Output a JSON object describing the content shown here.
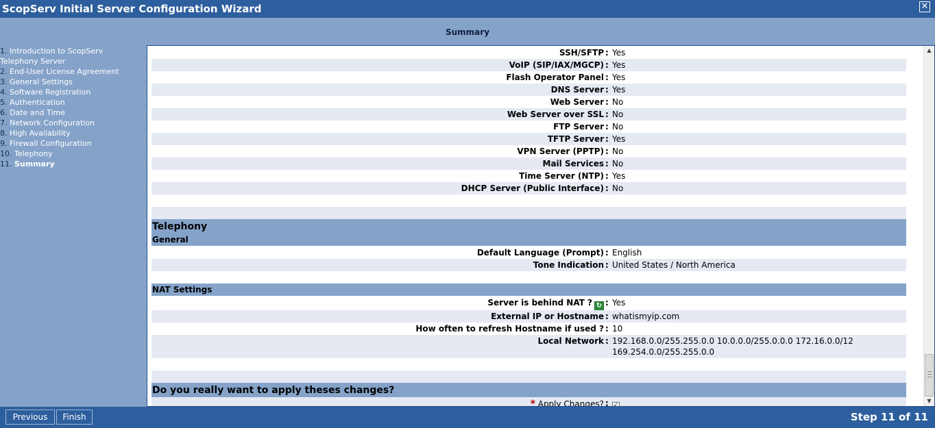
{
  "window": {
    "title": "ScopServ Initial Server Configuration Wizard",
    "close_glyph": "✕"
  },
  "header": {
    "title": "Summary"
  },
  "sidebar": {
    "steps": [
      {
        "num": "1.",
        "label": "Introduction to ScopServ",
        "label2": "Telephony Server"
      },
      {
        "num": "2.",
        "label": "End-User License Agreement"
      },
      {
        "num": "3.",
        "label": "General Settings"
      },
      {
        "num": "4.",
        "label": "Software Registration"
      },
      {
        "num": "5.",
        "label": "Authentication"
      },
      {
        "num": "6.",
        "label": "Date and Time"
      },
      {
        "num": "7.",
        "label": "Network Configuration"
      },
      {
        "num": "8.",
        "label": "High Availability"
      },
      {
        "num": "9.",
        "label": "Firewall Configuration"
      },
      {
        "num": "10.",
        "label": "Telephony"
      },
      {
        "num": "11.",
        "label": "Summary",
        "active": true
      }
    ]
  },
  "services": [
    {
      "key": "SSH/SFTP",
      "value": "Yes"
    },
    {
      "key": "VoIP (SIP/IAX/MGCP)",
      "value": "Yes"
    },
    {
      "key": "Flash Operator Panel",
      "value": "Yes"
    },
    {
      "key": "DNS Server",
      "value": "Yes"
    },
    {
      "key": "Web Server",
      "value": "No"
    },
    {
      "key": "Web Server over SSL",
      "value": "No"
    },
    {
      "key": "FTP Server",
      "value": "No"
    },
    {
      "key": "TFTP Server",
      "value": "Yes"
    },
    {
      "key": "VPN Server (PPTP)",
      "value": "No"
    },
    {
      "key": "Mail Services",
      "value": "No"
    },
    {
      "key": "Time Server (NTP)",
      "value": "Yes"
    },
    {
      "key": "DHCP Server (Public Interface)",
      "value": "No"
    }
  ],
  "separator": ":",
  "telephony": {
    "heading": "Telephony",
    "general_heading": "General",
    "general": [
      {
        "key": "Default Language (Prompt)",
        "value": "English"
      },
      {
        "key": "Tone Indication",
        "value": "United States / North America"
      }
    ],
    "nat_heading": "NAT Settings",
    "nat": {
      "behind_nat_key": "Server is behind NAT ?",
      "behind_nat_value": "Yes",
      "external_key": "External IP or Hostname",
      "external_value": "whatismyip.com",
      "refresh_key": "How often to refresh Hostname if used ?",
      "refresh_value": "10",
      "local_key": "Local Network",
      "local_value_line1": "192.168.0.0/255.255.0.0 10.0.0.0/255.0.0.0 172.16.0.0/12",
      "local_value_line2": "169.254.0.0/255.255.0.0"
    }
  },
  "confirm": {
    "heading": "Do you really want to apply theses changes?",
    "required_mark": "*",
    "apply_label": "Apply Changes?",
    "apply_checked": true,
    "check_glyph": "✓"
  },
  "footer": {
    "previous_label": "Previous",
    "finish_label": "Finish",
    "step_info": "Step 11 of 11"
  },
  "colors": {
    "titlebar": "#2d5e9d",
    "background": "#85a3c9",
    "row_alt": "#e4e9f2",
    "section_band": "#85a3c9"
  }
}
